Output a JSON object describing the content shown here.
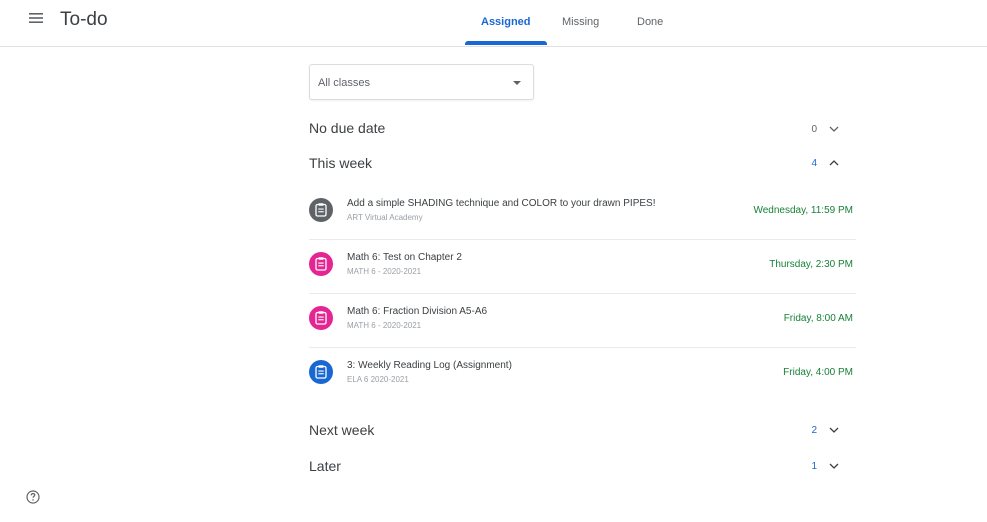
{
  "header": {
    "title": "To-do",
    "tabs": [
      {
        "label": "Assigned",
        "active": true
      },
      {
        "label": "Missing",
        "active": false
      },
      {
        "label": "Done",
        "active": false
      }
    ]
  },
  "filter": {
    "selected": "All classes"
  },
  "sections": {
    "no_due_date": {
      "label": "No due date",
      "count": "0",
      "expanded": false
    },
    "this_week": {
      "label": "This week",
      "count": "4",
      "expanded": true
    },
    "next_week": {
      "label": "Next week",
      "count": "2",
      "expanded": false
    },
    "later": {
      "label": "Later",
      "count": "1",
      "expanded": false
    }
  },
  "assignments": [
    {
      "title": "Add a simple SHADING technique and COLOR to your drawn PIPES!",
      "class": "ART Virtual Academy",
      "due": "Wednesday, 11:59 PM",
      "icon": "assignment-icon",
      "color": "#5f6368"
    },
    {
      "title": "Math 6: Test on Chapter 2",
      "class": "MATH 6 - 2020-2021",
      "due": "Thursday, 2:30 PM",
      "icon": "assignment-icon",
      "color": "#e52592"
    },
    {
      "title": "Math 6: Fraction Division A5-A6",
      "class": "MATH 6 - 2020-2021",
      "due": "Friday, 8:00 AM",
      "icon": "assignment-icon",
      "color": "#e52592"
    },
    {
      "title": "3: Weekly Reading Log (Assignment)",
      "class": "ELA 6 2020-2021",
      "due": "Friday, 4:00 PM",
      "icon": "assignment-icon",
      "color": "#1967d2"
    }
  ],
  "colors": {
    "accent": "#1967d2",
    "due_green": "#188038",
    "count_blue": "#1967d2",
    "count_gray": "#5f6368"
  },
  "icons": {
    "menu": "menu-icon",
    "help": "help-icon",
    "expand": "chevron-down-icon",
    "collapse": "chevron-up-icon"
  }
}
